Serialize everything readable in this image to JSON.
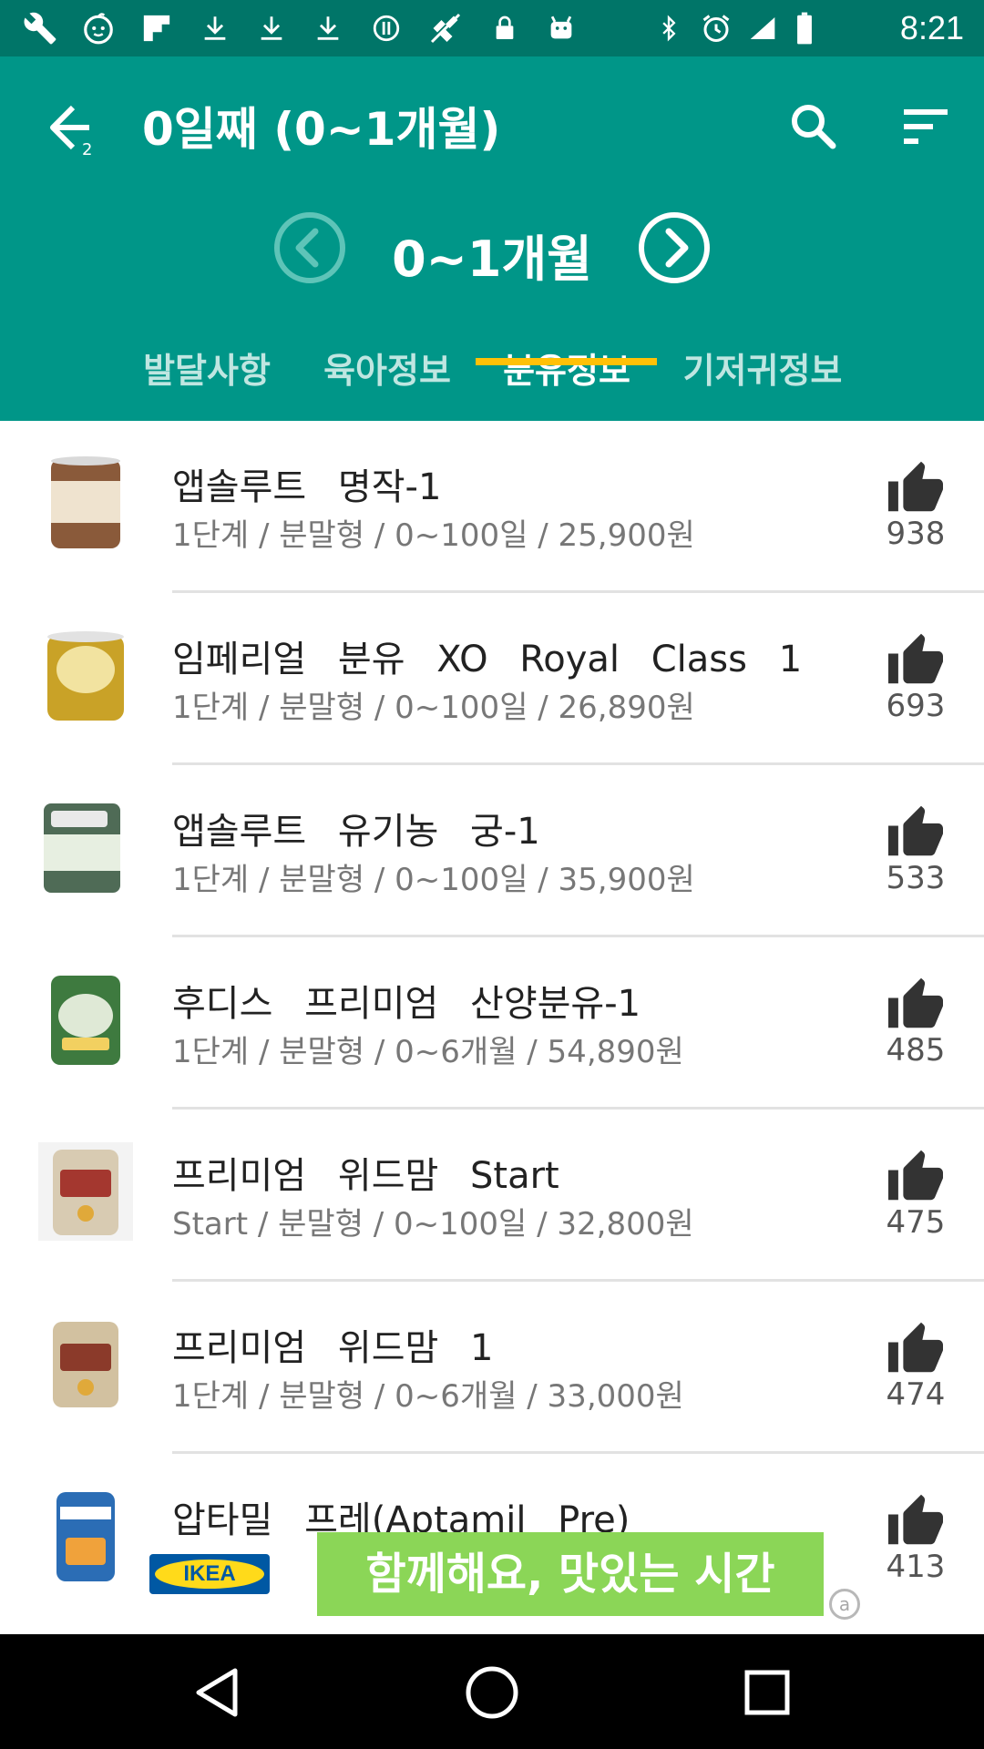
{
  "status_bar": {
    "time": "8:21",
    "icons": [
      "wrench-icon",
      "baby-face-icon",
      "flipboard-icon",
      "download-icon",
      "download-icon",
      "download-icon",
      "info-icon",
      "no-signal-icon",
      "lock-icon",
      "android-icon",
      "bluetooth-icon",
      "alarm-icon"
    ]
  },
  "header": {
    "title": "0일째 (0~1개월)",
    "back_badge": "2"
  },
  "month_nav": {
    "label": "0~1개월"
  },
  "tabs": [
    {
      "label": "발달사항",
      "active": false
    },
    {
      "label": "육아정보",
      "active": false
    },
    {
      "label": "분유정보",
      "active": true
    },
    {
      "label": "기저귀정보",
      "active": false
    }
  ],
  "products": [
    {
      "name": "앱솔루트 명작-1",
      "details": "1단계 / 분말형 / 0~100일 / 25,900원",
      "likes": "938",
      "can_color": "#8a5a3a",
      "label_color": "#efe3cf"
    },
    {
      "name": "임페리얼 분유 XO Royal Class 1",
      "details": "1단계 / 분말형 / 0~100일 / 26,890원",
      "likes": "693",
      "can_color": "#c9a227",
      "label_color": "#f2e3a0"
    },
    {
      "name": "앱솔루트 유기농 궁-1",
      "details": "1단계 / 분말형 / 0~100일 / 35,900원",
      "likes": "533",
      "can_color": "#4f6b56",
      "label_color": "#e7efe1"
    },
    {
      "name": "후디스 프리미엄 산양분유-1",
      "details": "1단계 / 분말형 / 0~6개월 / 54,890원",
      "likes": "485",
      "can_color": "#3e7a3f",
      "label_color": "#dfe9d6"
    },
    {
      "name": "프리미엄 위드맘 Start",
      "details": "Start / 분말형 / 0~100일 / 32,800원",
      "likes": "475",
      "can_color": "#d8cbb2",
      "label_color": "#a4372f"
    },
    {
      "name": "프리미엄 위드맘 1",
      "details": "1단계 / 분말형 / 0~6개월 / 33,000원",
      "likes": "474",
      "can_color": "#d2c1a0",
      "label_color": "#8b3a2a"
    },
    {
      "name": "압타밀 프레(Aptamil Pre)",
      "details": "",
      "likes": "413",
      "can_color": "#2b6db5",
      "label_color": "#f0a23b"
    }
  ],
  "ad": {
    "brand": "IKEA",
    "text": "함께해요, 맛있는 시간"
  },
  "colors": {
    "primary": "#009688",
    "status_bar": "#007568",
    "tab_indicator": "#ffc107",
    "like_icon": "#333333"
  }
}
